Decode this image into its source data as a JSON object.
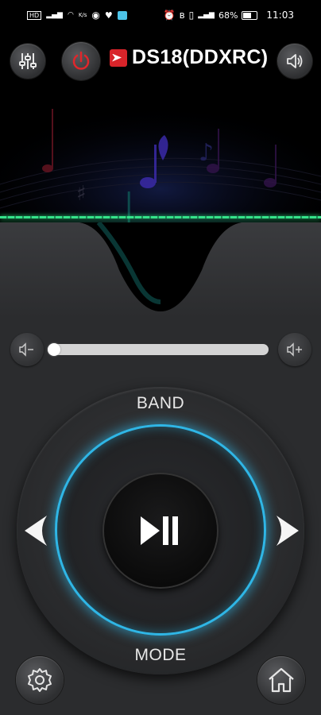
{
  "status": {
    "battery": "68%",
    "time": "11:03"
  },
  "header": {
    "title": "DS18(DDXRC)",
    "icons": [
      "equalizer-icon",
      "power-icon",
      "ds18-logo",
      "speaker-icon"
    ]
  },
  "volume": {
    "down_icon": "volume-down-icon",
    "up_icon": "volume-up-icon",
    "level": 0.0
  },
  "controls": {
    "band_label": "BAND",
    "mode_label": "MODE",
    "center_icon": "play-pause-icon",
    "prev_icon": "arrow-left-icon",
    "next_icon": "arrow-right-icon"
  },
  "footer": {
    "settings_icon": "gear-icon",
    "home_icon": "home-icon"
  },
  "colors": {
    "accent_ring": "#2fb6e6",
    "glow_line": "#35e38a",
    "power_red": "#e0262b",
    "background": "#2b2c2e"
  }
}
